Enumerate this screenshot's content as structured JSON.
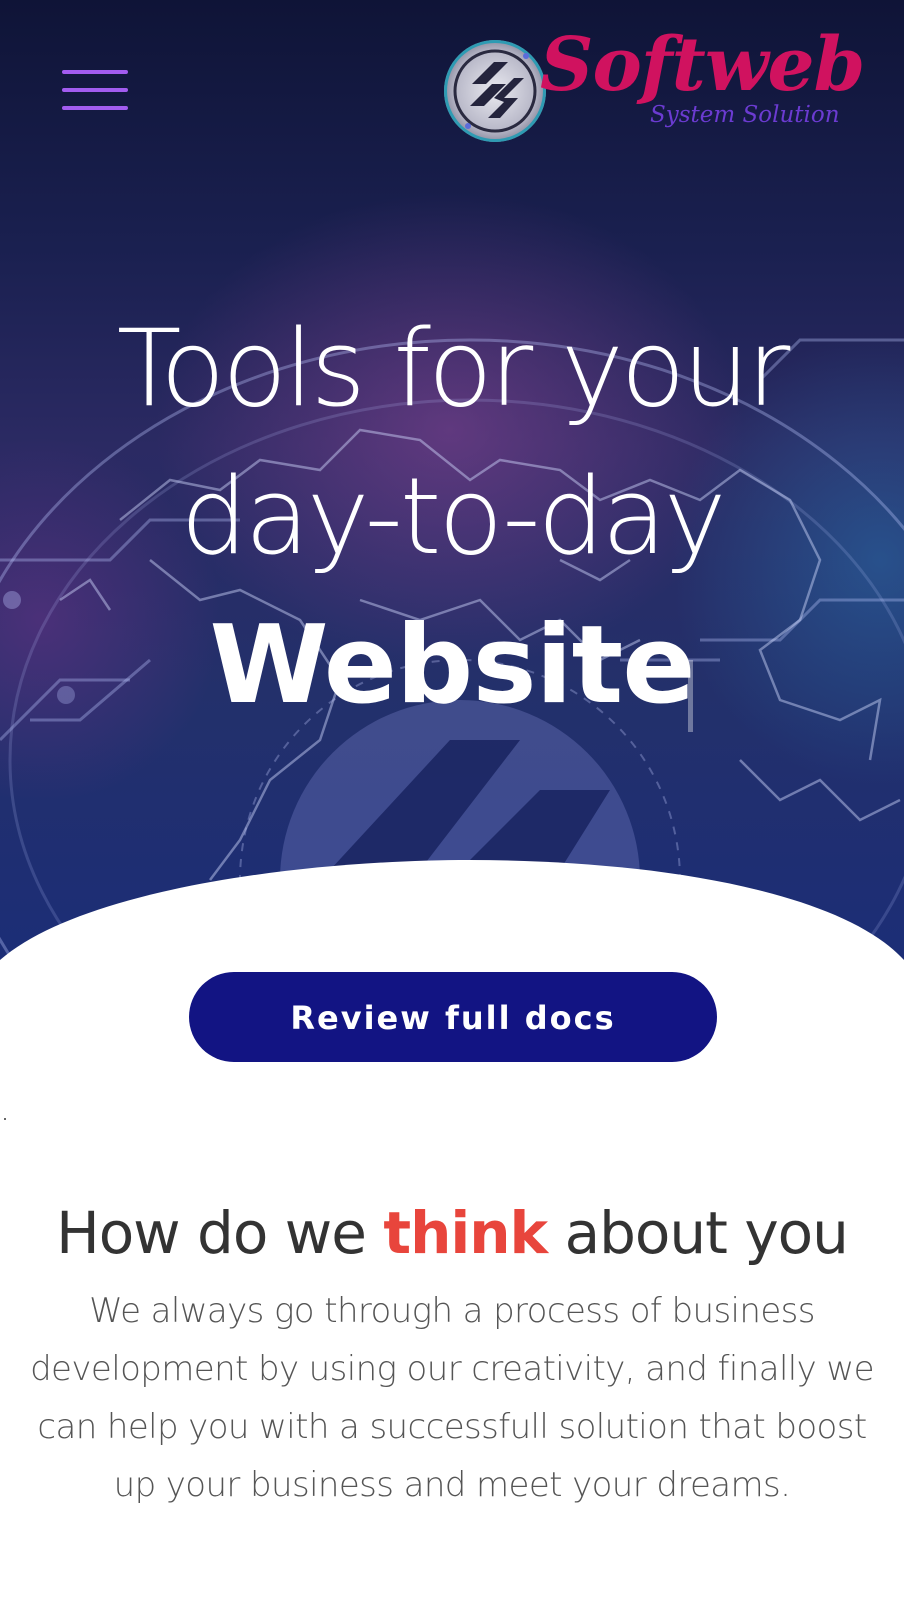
{
  "header": {
    "brand_name": "Softweb",
    "brand_tagline": "System Solution"
  },
  "hero": {
    "line1": "Tools for your",
    "line2": "day-to-day",
    "line3": "Website"
  },
  "cta": {
    "label": "Review full docs"
  },
  "about": {
    "heading_pre": "How do we",
    "heading_accent": "think",
    "heading_post": "about you",
    "body": "We always go through a process of business development by using our creativity, and finally we can help you with a successfull solution that boost up your business and meet your dreams."
  },
  "colors": {
    "menu_icon": "#a25cf0",
    "brand": "#d0125f",
    "brand_tagline": "#6b3bd1",
    "cta_background": "#121483",
    "accent": "#e8453c"
  },
  "icons": {
    "menu": "hamburger-menu-icon",
    "logo": "softweb-logo-icon"
  }
}
